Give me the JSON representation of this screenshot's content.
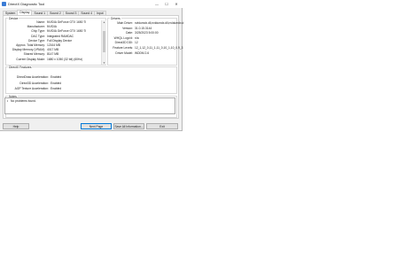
{
  "window": {
    "title": "DirectX Diagnostic Tool",
    "caption_buttons": [
      "—",
      "☐",
      "✕"
    ]
  },
  "tabs": [
    "System",
    "Display",
    "Sound 1",
    "Sound 2",
    "Sound 3",
    "Sound 4",
    "Input"
  ],
  "active_tab": "Display",
  "device": {
    "title": "Device",
    "rows": [
      {
        "k": "Name:",
        "v": "NVIDIA GeForce GTX 1650 Ti"
      },
      {
        "k": "Manufacturer:",
        "v": "NVIDIA"
      },
      {
        "k": "Chip Type:",
        "v": "NVIDIA GeForce GTX 1650 Ti"
      },
      {
        "k": "DAC Type:",
        "v": "Integrated RAMDAC"
      },
      {
        "k": "Device Type:",
        "v": "Full Display Device"
      },
      {
        "k": "Approx. Total Memory:",
        "v": "12164 MB"
      },
      {
        "k": "Display Memory (VRAM):",
        "v": "4017 MB"
      },
      {
        "k": "Shared Memory:",
        "v": "8147 MB"
      },
      {
        "k": "Current Display Mode:",
        "v": "1680 x 1050 (32 bit) (60Hz)"
      }
    ]
  },
  "drivers": {
    "title": "Drivers",
    "rows": [
      {
        "k": "Main Driver:",
        "v": "nvldumdx.dll,nvldumdx.dll,nvldumdx.d"
      },
      {
        "k": "Version:",
        "v": "31.0.15.3144"
      },
      {
        "k": "Date:",
        "v": "3/25/2023 5:00:00"
      },
      {
        "k": "WHQL Logo'd:",
        "v": "n/a"
      },
      {
        "k": "Direct3D DDI:",
        "v": "12"
      },
      {
        "k": "Feature Levels:",
        "v": "12_1,12_0,11_1,11_0,10_1,10_0,9_3"
      },
      {
        "k": "Driver Model:",
        "v": "WDDM 2.6"
      }
    ]
  },
  "features": {
    "title": "DirectX Features",
    "rows": [
      {
        "k": "DirectDraw Acceleration:",
        "v": "Enabled"
      },
      {
        "k": "Direct3D Acceleration:",
        "v": "Enabled"
      },
      {
        "k": "AGP Texture Acceleration:",
        "v": "Enabled"
      }
    ]
  },
  "notes": {
    "title": "Notes",
    "bullet": "•",
    "text": "No problems found."
  },
  "buttons": {
    "help": "Help",
    "next_page": "Next Page",
    "save_all": "Save All Information...",
    "exit": "Exit"
  }
}
